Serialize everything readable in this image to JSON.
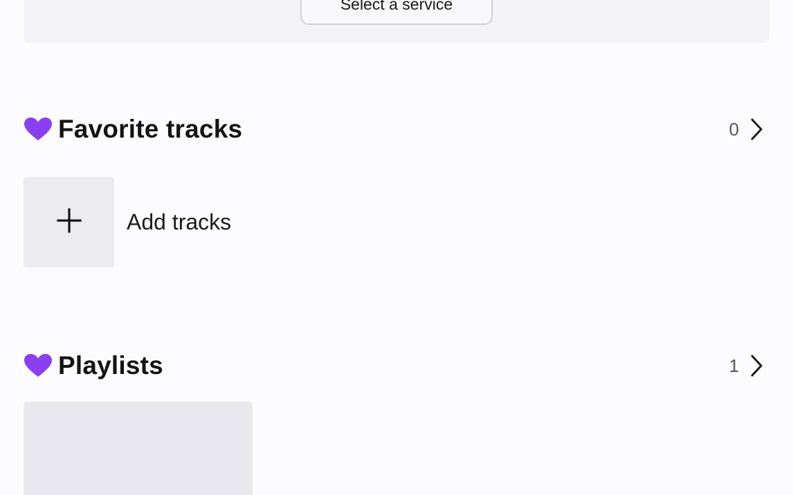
{
  "service": {
    "button_label": "Select a service"
  },
  "favorites": {
    "title": "Favorite tracks",
    "count": "0",
    "add_label": "Add tracks"
  },
  "playlists": {
    "title": "Playlists",
    "count": "1"
  },
  "icons": {
    "heart": "heart-icon",
    "chevron": "chevron-right-icon",
    "plus": "plus-icon"
  },
  "colors": {
    "accent": "#8a3ff0",
    "background": "#fcfcfe",
    "tile": "#ebebf0"
  }
}
